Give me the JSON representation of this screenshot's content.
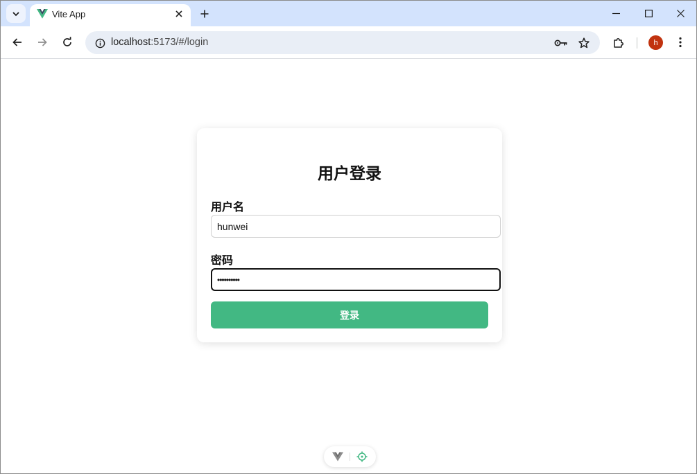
{
  "browser": {
    "tab_title": "Vite App",
    "url_host": "localhost",
    "url_rest": ":5173/#/login",
    "avatar_letter": "h",
    "avatar_color": "#c1330f",
    "accent": "#d3e3fd"
  },
  "login": {
    "title": "用户登录",
    "username_label": "用户名",
    "username_value": "hunwei",
    "password_label": "密码",
    "password_value": "••••••••••",
    "submit_label": "登录",
    "button_color": "#42b883"
  },
  "icons": {
    "tab_search": "chevron-down-icon",
    "favicon": "vue-logo-icon",
    "close": "close-icon",
    "new_tab": "plus-icon",
    "back": "arrow-left-icon",
    "forward": "arrow-right-icon",
    "reload": "reload-icon",
    "site_info": "info-icon",
    "password_key": "key-icon",
    "bookmark": "star-icon",
    "extensions": "puzzle-icon",
    "menu": "kebab-menu-icon",
    "devtools_vue": "vue-logo-icon",
    "devtools_inspect": "target-icon"
  }
}
